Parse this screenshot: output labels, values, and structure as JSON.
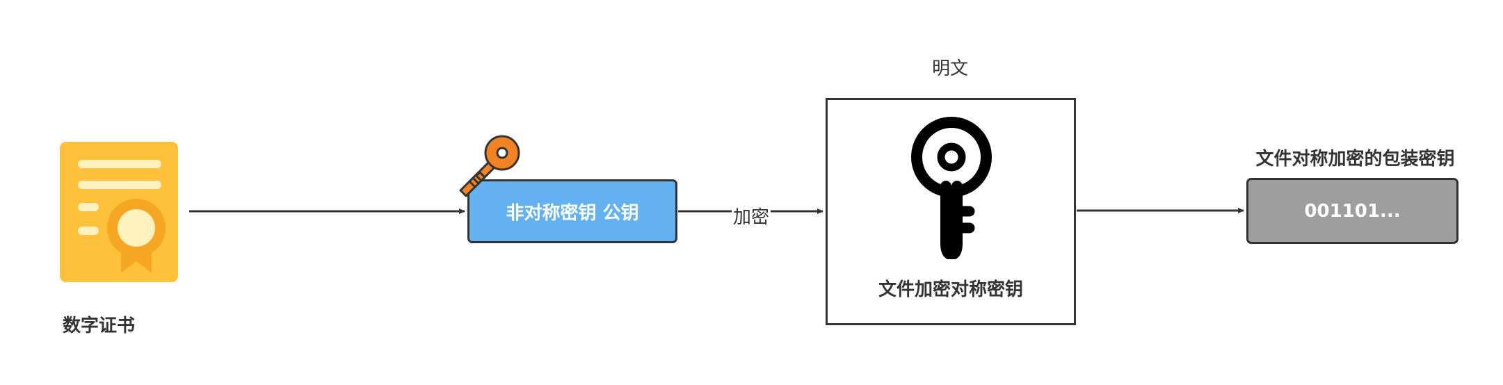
{
  "nodes": {
    "certificate": {
      "label": "数字证书",
      "icon": "certificate-icon",
      "color": "#ffc13b"
    },
    "public_key": {
      "label": "非对称密钥 公钥",
      "icon": "key-icon",
      "fill": "#63b1f0",
      "icon_color": "#f08425"
    },
    "symmetric_key": {
      "header": "明文",
      "caption": "文件加密对称密钥",
      "icon": "key-icon"
    },
    "wrapped_key": {
      "title": "文件对称加密的包装密钥",
      "value": "001101...",
      "fill": "#9e9e9e"
    }
  },
  "edges": {
    "encrypt_label": "加密"
  },
  "colors": {
    "stroke": "#333333",
    "text": "#333333"
  }
}
